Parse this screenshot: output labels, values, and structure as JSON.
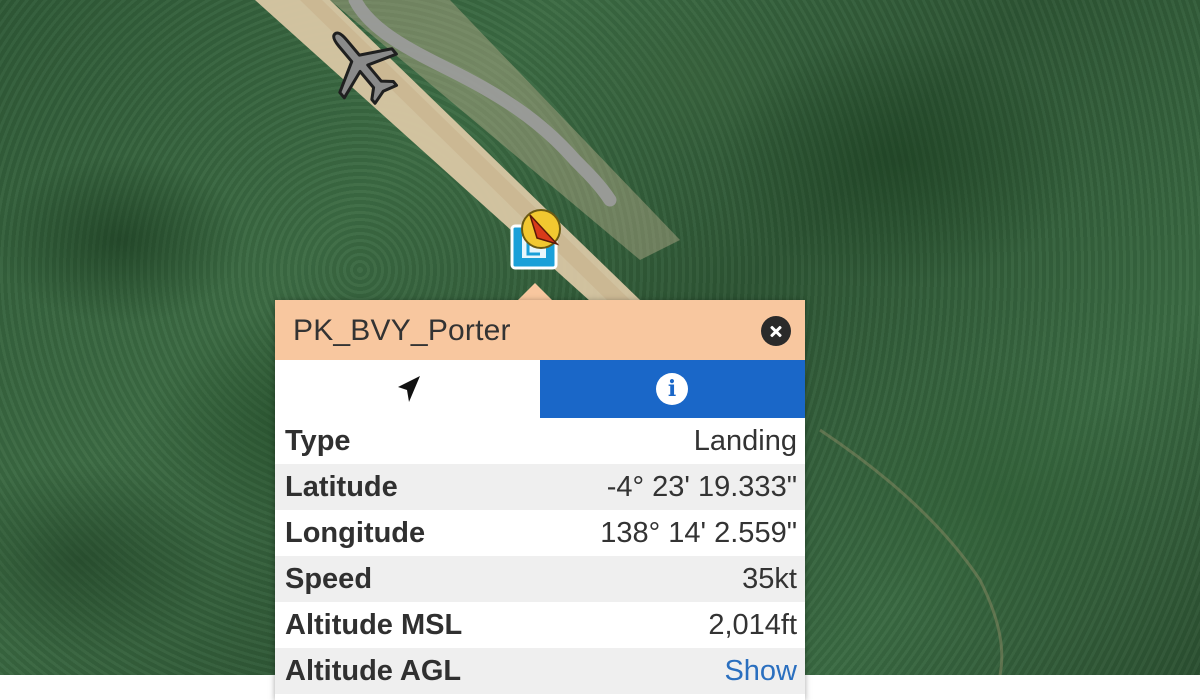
{
  "popup": {
    "title": "PK_BVY_Porter",
    "rows": [
      {
        "label": "Type",
        "value": "Landing"
      },
      {
        "label": "Latitude",
        "value": "-4° 23' 19.333\""
      },
      {
        "label": "Longitude",
        "value": "138° 14' 2.559\""
      },
      {
        "label": "Speed",
        "value": "35kt"
      },
      {
        "label": "Altitude MSL",
        "value": "2,014ft"
      },
      {
        "label": "Altitude AGL",
        "value": "Show"
      }
    ]
  },
  "icons": {
    "close": "close-icon",
    "navigate": "navigation-arrow-icon",
    "info": "info-icon",
    "airport": "airplane-icon",
    "aircraft_marker": "aircraft-marker-icon"
  },
  "colors": {
    "popup_header": "#f8c79f",
    "active_tab": "#1a67c8",
    "link": "#2a6fbf",
    "marker_arrow": "#d93a1a",
    "marker_ring": "#f2c830"
  }
}
